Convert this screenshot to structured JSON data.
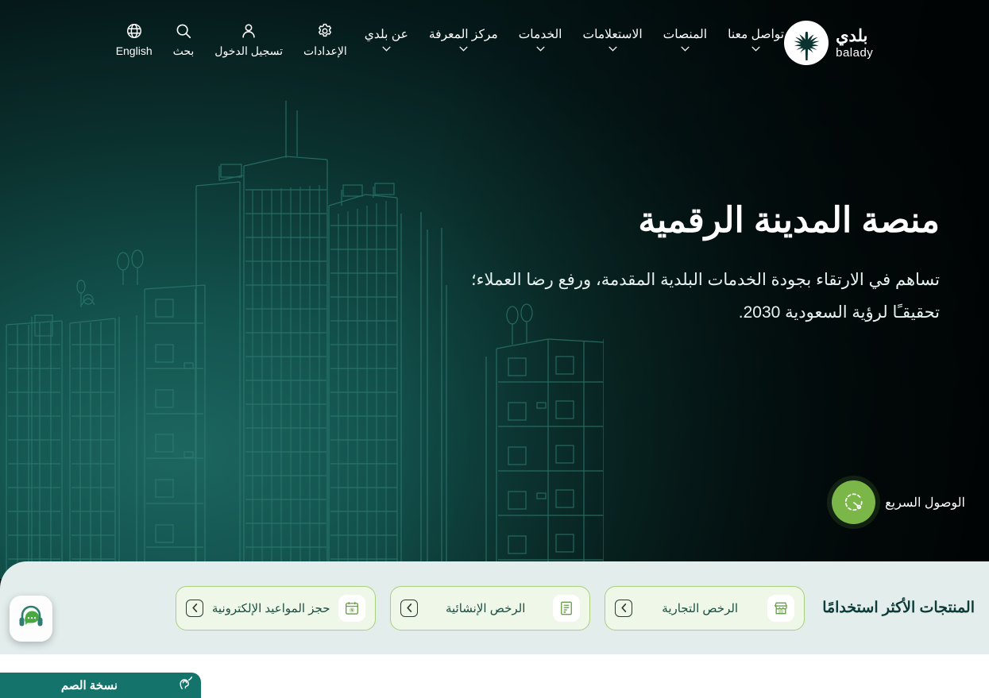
{
  "header": {
    "logo": {
      "arabic": "بلدي",
      "english": "balady",
      "mark": "palm-tree-emblem"
    },
    "nav": [
      {
        "label": "عن بلدي",
        "icon": "chevron-down-icon"
      },
      {
        "label": "مركز المعرفة",
        "icon": "chevron-down-icon"
      },
      {
        "label": "الخدمات",
        "icon": "chevron-down-icon"
      },
      {
        "label": "الاستعلامات",
        "icon": "chevron-down-icon"
      },
      {
        "label": "المنصات",
        "icon": "chevron-down-icon"
      },
      {
        "label": "تواصل معنا",
        "icon": "chevron-down-icon"
      }
    ],
    "tools": [
      {
        "label": "English",
        "icon": "globe-icon"
      },
      {
        "label": "بحث",
        "icon": "search-icon"
      },
      {
        "label": "تسجيل الدخول",
        "icon": "user-icon"
      },
      {
        "label": "الإعدادات",
        "icon": "gear-icon"
      }
    ]
  },
  "hero": {
    "title": "منصة المدينة الرقمية",
    "subtitle": "تساهم في الارتقاء بجودة الخدمات البلدية المقدمة، ورفع رضا العملاء؛ تحقيقـًا لرؤية السعودية 2030.",
    "quick_access": {
      "label": "الوصول السريع",
      "icon": "speedometer-icon"
    }
  },
  "products": {
    "title": "المنتجات الأكثر استخدامًا",
    "items": [
      {
        "label": "الرخص التجارية",
        "icon": "storefront-icon",
        "go_icon": "chevron-left-icon"
      },
      {
        "label": "الرخص الإنشائية",
        "icon": "document-license-icon",
        "go_icon": "chevron-left-icon"
      },
      {
        "label": "حجز المواعيد الإلكترونية",
        "icon": "calendar-booking-icon",
        "go_icon": "chevron-left-icon"
      }
    ]
  },
  "widgets": {
    "chat": {
      "name": "support-chat",
      "icon": "headset-chat-icon"
    },
    "deaf_version": {
      "label": "نسخة الصم",
      "icon": "sign-language-icon"
    }
  },
  "colors": {
    "brand_dark": "#0b322f",
    "brand_teal": "#14746b",
    "accent_green": "#7ab648",
    "strip_bg": "#e3eeec",
    "card_bg": "#eff7e9",
    "card_border": "#a9d07d"
  }
}
